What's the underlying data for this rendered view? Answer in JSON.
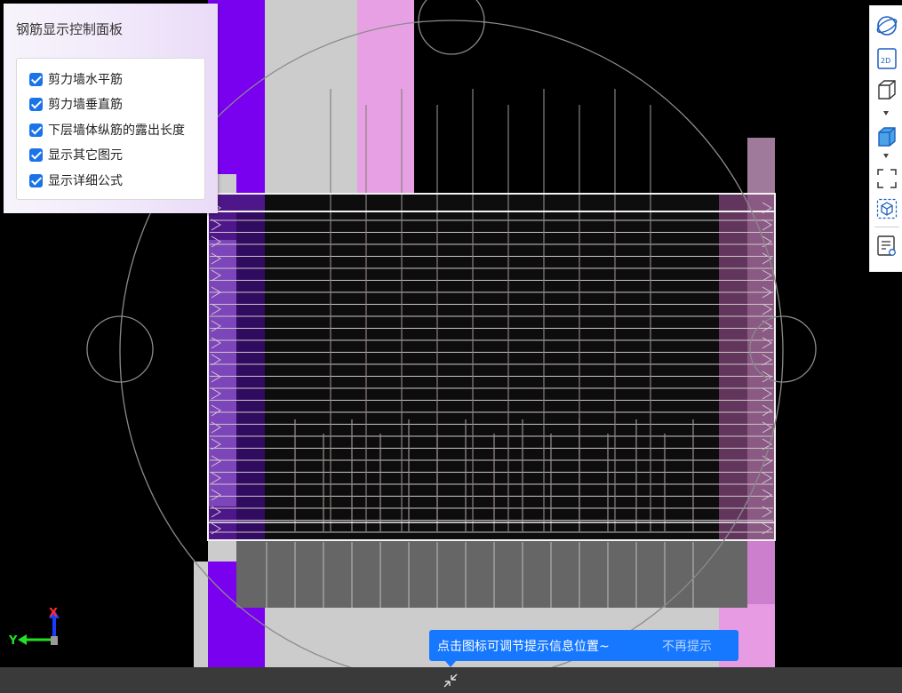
{
  "panel": {
    "title": "钢筋显示控制面板",
    "options": [
      {
        "label": "剪力墙水平筋",
        "checked": true
      },
      {
        "label": "剪力墙垂直筋",
        "checked": true
      },
      {
        "label": "下层墙体纵筋的露出长度",
        "checked": true
      },
      {
        "label": "显示其它图元",
        "checked": true
      },
      {
        "label": "显示详细公式",
        "checked": true
      }
    ]
  },
  "toolbar": {
    "icons": [
      "orbit-icon",
      "view-2d-icon",
      "cube-outline-icon",
      "cube-filled-icon",
      "fit-view-icon",
      "isolate-icon",
      "property-list-icon"
    ],
    "view_2d_label": "2D"
  },
  "tip": {
    "text": "点击图标可调节提示信息位置~",
    "dismiss_label": "不再提示"
  },
  "axis": {
    "x_label": "X",
    "y_label": "Y"
  },
  "colors": {
    "violet": "#7a00f0",
    "pink": "#e79be3",
    "light_gray": "#cccccc",
    "mid_gray": "#666666",
    "accent_blue": "#1677ff",
    "checkbox_blue": "#1a73e8"
  }
}
